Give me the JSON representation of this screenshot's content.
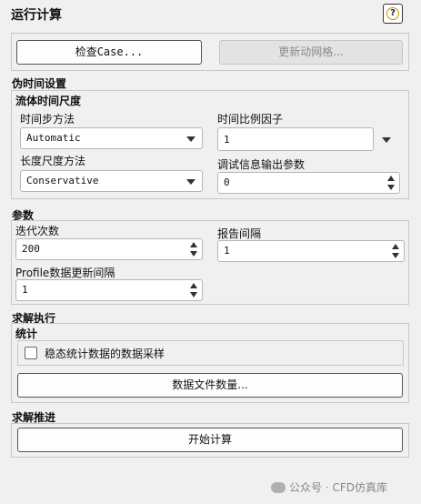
{
  "header": {
    "title": "运行计算",
    "help_glyph": "?"
  },
  "top_buttons": {
    "check_case": "检查Case...",
    "update_mesh": "更新动网格..."
  },
  "pseudo_time": {
    "section": "伪时间设置",
    "fluid_time_scale": {
      "section": "流体时间尺度",
      "time_step_method": {
        "label": "时间步方法",
        "value": "Automatic"
      },
      "time_scale_factor": {
        "label": "时间比例因子",
        "value": "1"
      },
      "length_scale_method": {
        "label": "长度尺度方法",
        "value": "Conservative"
      },
      "verbosity": {
        "label": "调试信息输出参数",
        "value": "0"
      }
    }
  },
  "parameters": {
    "section": "参数",
    "iterations": {
      "label": "迭代次数",
      "value": "200"
    },
    "report_interval": {
      "label": "报告间隔",
      "value": "1"
    },
    "profile_update": {
      "label": "Profile数据更新间隔",
      "value": "1"
    }
  },
  "solution_processing": {
    "section": "求解执行",
    "statistics": {
      "section": "统计",
      "sampling_checkbox": {
        "label": "稳态统计数据的数据采样",
        "checked": false
      }
    },
    "data_file_quantities": "数据文件数量..."
  },
  "solution_advancement": {
    "section": "求解推进",
    "calculate": "开始计算"
  },
  "watermark": {
    "text": "公众号 · CFD仿真库"
  }
}
